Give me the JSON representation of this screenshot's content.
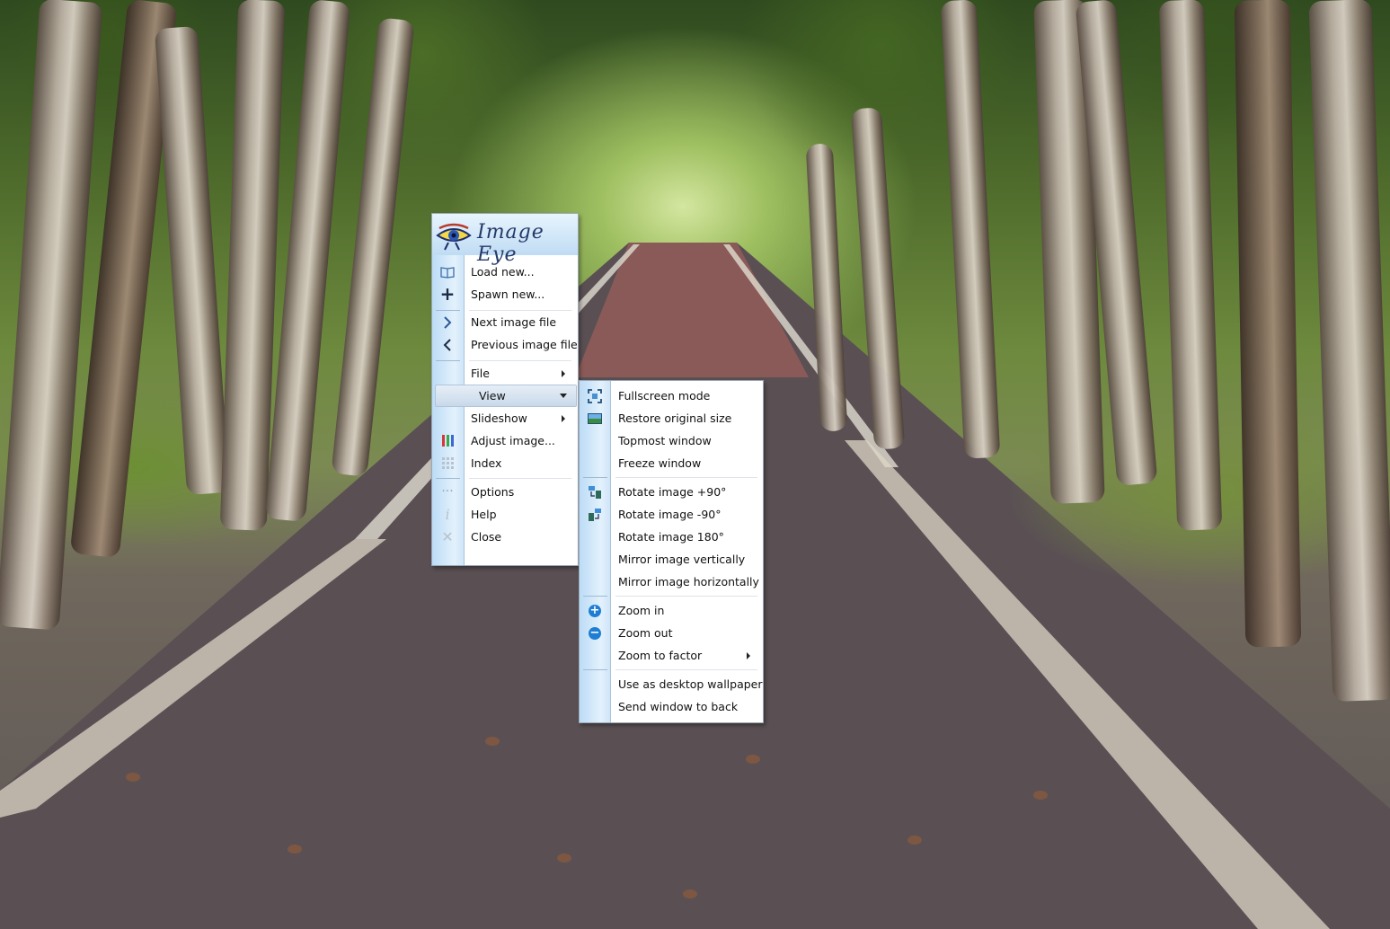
{
  "app": {
    "logo_text": "Image Eye"
  },
  "main_menu": {
    "items": [
      {
        "label": "Load new...",
        "icon": "book-icon"
      },
      {
        "label": "Spawn new...",
        "icon": "plus-icon"
      },
      {
        "label": "Next image file",
        "icon": "chevron-right-icon"
      },
      {
        "label": "Previous image file",
        "icon": "chevron-left-icon"
      },
      {
        "label": "File",
        "submenu": true
      },
      {
        "label": "View",
        "submenu": true,
        "selected": true
      },
      {
        "label": "Slideshow",
        "submenu": true
      },
      {
        "label": "Adjust image...",
        "icon": "color-bars-icon"
      },
      {
        "label": "Index",
        "icon": "grid-icon"
      },
      {
        "label": "Options",
        "icon": "ellipsis-icon"
      },
      {
        "label": "Help",
        "icon": "info-icon"
      },
      {
        "label": "Close",
        "icon": "close-icon"
      }
    ]
  },
  "view_submenu": {
    "items": [
      {
        "label": "Fullscreen mode",
        "icon": "fullscreen-icon"
      },
      {
        "label": "Restore original size",
        "icon": "image-icon"
      },
      {
        "label": "Topmost window"
      },
      {
        "label": "Freeze window"
      },
      {
        "label": "Rotate image +90°",
        "icon": "rotate-right-icon"
      },
      {
        "label": "Rotate image -90°",
        "icon": "rotate-left-icon"
      },
      {
        "label": "Rotate image 180°"
      },
      {
        "label": "Mirror image vertically"
      },
      {
        "label": "Mirror image horizontally"
      },
      {
        "label": "Zoom in",
        "icon": "zoom-in-icon"
      },
      {
        "label": "Zoom out",
        "icon": "zoom-out-icon"
      },
      {
        "label": "Zoom to factor",
        "submenu": true
      },
      {
        "label": "Use as desktop wallpaper"
      },
      {
        "label": "Send window to back"
      }
    ]
  },
  "colors": {
    "gutter": "#bcdcf6",
    "selection": "#c9d9ea",
    "menu_border": "#9aa6b4"
  }
}
